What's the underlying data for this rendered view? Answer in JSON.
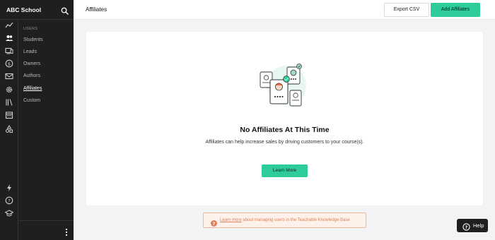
{
  "sidebar": {
    "school_name": "ABC School",
    "section_label": "USERS",
    "items": [
      {
        "label": "Students"
      },
      {
        "label": "Leads"
      },
      {
        "label": "Owners"
      },
      {
        "label": "Authors"
      },
      {
        "label": "Affiliates",
        "active": true
      },
      {
        "label": "Custom"
      }
    ],
    "rail_icons": [
      "trend-line-icon",
      "users-icon",
      "site-icon",
      "dollar-icon",
      "mail-icon",
      "settings-gear-icon",
      "library-icon",
      "calendar-icon",
      "apps-icon",
      "lightning-icon",
      "help-circle-icon",
      "graduation-cap-icon"
    ]
  },
  "header": {
    "title": "Affiliates",
    "export_label": "Export CSV",
    "add_label": "Add Affiliates"
  },
  "empty_state": {
    "title": "No Affiliates At This Time",
    "description": "Affiliates can help increase sales by driving customers to your course(s).",
    "button_label": "Learn More"
  },
  "banner": {
    "link_text": "Learn more",
    "text": " about managing users in the Teachable Knowledge Base"
  },
  "help": {
    "label": "Help"
  },
  "colors": {
    "accent": "#2ecc9a",
    "sidebar_bg": "#1f1f1f",
    "banner_text": "#e0805a",
    "banner_bg": "#fdf1ea"
  }
}
